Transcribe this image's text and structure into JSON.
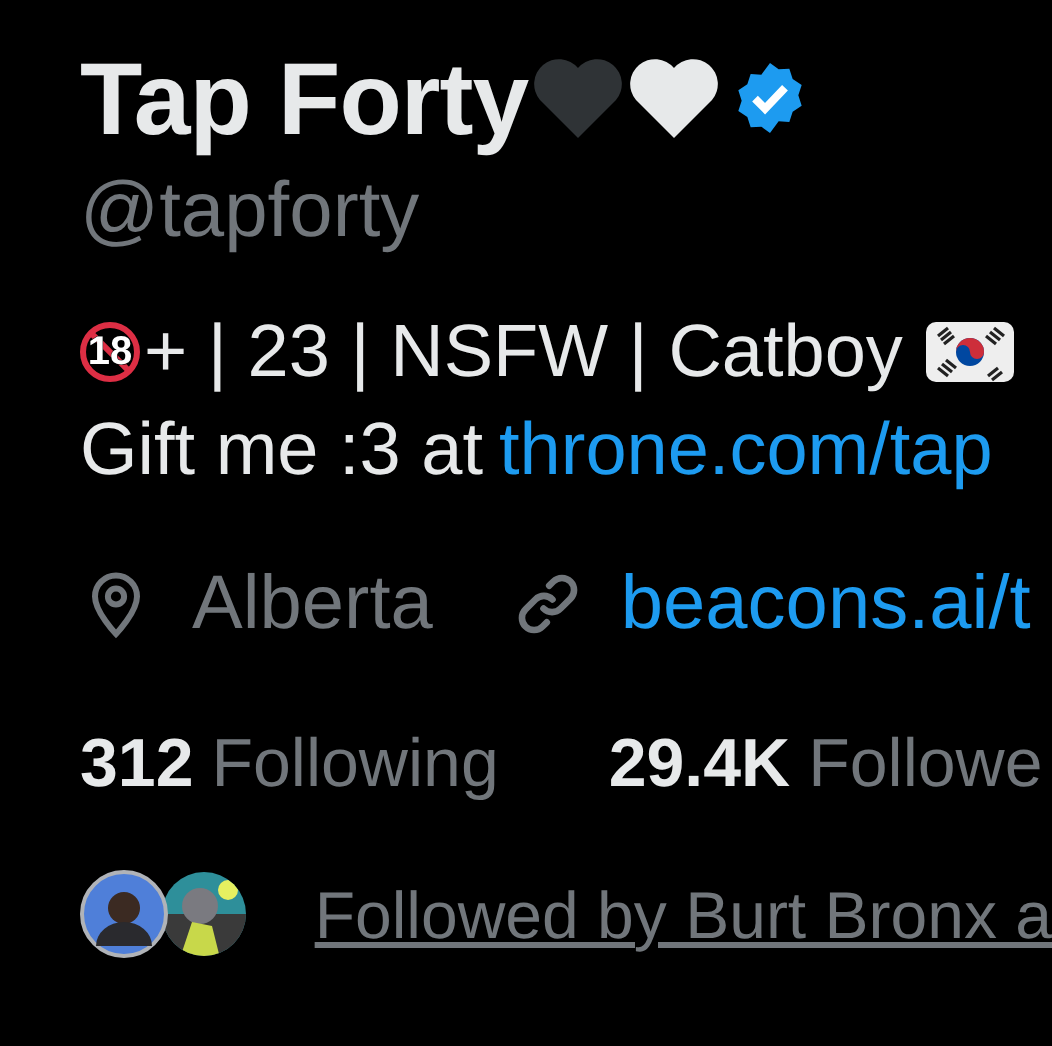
{
  "profile": {
    "name": "Tap Forty",
    "verified": true,
    "handle": "@tapforty"
  },
  "bio": {
    "badge": "18",
    "line_1": "+ | 23 | NSFW | Catboy",
    "line_2": "Gift me :3 at",
    "link": "throne.com/tap"
  },
  "details": {
    "location": "Alberta",
    "website": "beacons.ai/t"
  },
  "stats": [
    {
      "count": "312",
      "label": "Following"
    },
    {
      "count": "29.4K",
      "label": "Followe"
    }
  ],
  "followed_by": "Followed by Burt Bronx a"
}
